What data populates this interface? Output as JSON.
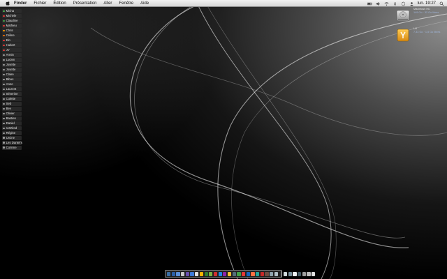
{
  "menubar": {
    "app_name": "Finder",
    "items": [
      "Fichier",
      "Édition",
      "Présentation",
      "Aller",
      "Fenêtre",
      "Aide"
    ],
    "clock": "lun. 19:27",
    "status_icons": [
      "battery-icon",
      "volume-icon",
      "wifi-icon",
      "bluetooth-icon",
      "sync-icon",
      "user-icon",
      "spotlight-icon"
    ]
  },
  "user_list": [
    {
      "name": "Micha",
      "color": "#4caf50"
    },
    {
      "name": "Michèle",
      "color": "#e53935"
    },
    {
      "name": "Claudine",
      "color": "#43a047"
    },
    {
      "name": "Mathieu",
      "color": "#e53935"
    },
    {
      "name": "Chris",
      "color": "#ff9800"
    },
    {
      "name": "Céline",
      "color": "#ef6c00"
    },
    {
      "name": "Elo",
      "color": "#e53935"
    },
    {
      "name": "Hubert",
      "color": "#e53935"
    },
    {
      "name": "JV",
      "color": "#e53935"
    },
    {
      "name": "Armin",
      "color": "#9e9e9e"
    },
    {
      "name": "Lucien",
      "color": "#9e9e9e"
    },
    {
      "name": "Josette",
      "color": "#9e9e9e"
    },
    {
      "name": "Josette",
      "color": "#9e9e9e"
    },
    {
      "name": "Claire",
      "color": "#9e9e9e"
    },
    {
      "name": "Bibus",
      "color": "#9e9e9e"
    },
    {
      "name": "Anne",
      "color": "#9e9e9e"
    },
    {
      "name": "Laurent",
      "color": "#9e9e9e"
    },
    {
      "name": "Séverine",
      "color": "#9e9e9e"
    },
    {
      "name": "Colette",
      "color": "#9e9e9e"
    },
    {
      "name": "Seb",
      "color": "#9e9e9e"
    },
    {
      "name": "Bev",
      "color": "#9e9e9e"
    },
    {
      "name": "Olivier",
      "color": "#9e9e9e"
    },
    {
      "name": "Bastien",
      "color": "#9e9e9e"
    },
    {
      "name": "Daniel",
      "color": "#9e9e9e"
    },
    {
      "name": "scWired",
      "color": "#9e9e9e"
    },
    {
      "name": "Régine",
      "color": "#9e9e9e"
    },
    {
      "name": "Urcine",
      "color": "#9e9e9e"
    },
    {
      "name": "Les Daniel's",
      "color": "#9e9e9e"
    },
    {
      "name": "Corinne",
      "color": "#9e9e9e"
    }
  ],
  "desktop_icons": [
    {
      "name": "Macintosh HD",
      "sub": "149 Go · 32 Go libres",
      "icon": "hard-drive-icon"
    },
    {
      "name": "LG",
      "sub": "7,33 Go · 1,5 Go libres",
      "icon": "external-drive-icon"
    }
  ],
  "dock": {
    "colors": [
      "#3a6ea5",
      "#2b5fa8",
      "#5a8fd8",
      "#c9c9c9",
      "#6a4fb0",
      "#3d7bd9",
      "#e0e0e0",
      "#f4b400",
      "#2e7d32",
      "#7cb342",
      "#d32f2f",
      "#1e88e5",
      "#8e24aa",
      "#fbc02d",
      "#546e7a",
      "#43a047",
      "#e53935",
      "#1565c0",
      "#ff7043",
      "#26a69a",
      "#c62828",
      "#6d4c41",
      "#90a4ae",
      "#b0bec5",
      "#cfd8dc",
      "#78909c",
      "#eceff1",
      "#455a64",
      "#9e9e9e",
      "#bdbdbd",
      "#e0e0e0"
    ]
  }
}
